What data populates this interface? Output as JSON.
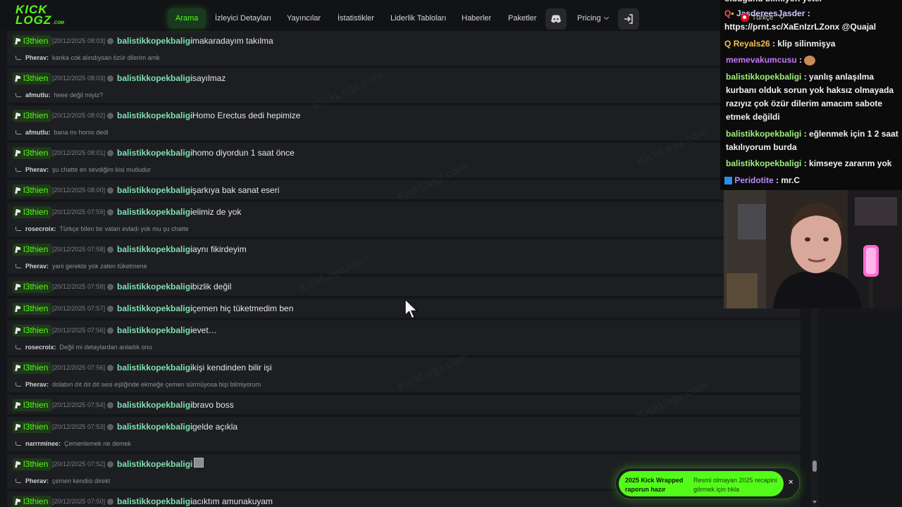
{
  "navbar": {
    "logo_top": "KICK",
    "logo_bottom": "LOGZ",
    "logo_suffix": ".COM",
    "items": [
      "Arama",
      "İzleyici Detayları",
      "Yayıncılar",
      "İstatistikler",
      "Liderlik Tabloları",
      "Haberler",
      "Paketler"
    ],
    "pricing": "Pricing",
    "language": "Türkçe"
  },
  "messages": [
    {
      "channel": "l3thien",
      "time": "[20/12/2025 08:03]",
      "user": "balistikkopekbaligi",
      "text": "makaradayım takılma",
      "reply_user": "Pherav:",
      "reply_text": "kanka cok alındıysan özür dilerim amk"
    },
    {
      "channel": "l3thien",
      "time": "[20/12/2025 08:03]",
      "user": "balistikkopekbaligi",
      "text": "sayılmaz",
      "reply_user": "afmutlu:",
      "reply_text": "heee değil miyiz?"
    },
    {
      "channel": "l3thien",
      "time": "[20/12/2025 08:02]",
      "user": "balistikkopekbaligi",
      "text": "Homo Erectus dedi hepimize",
      "reply_user": "afmutlu:",
      "reply_text": "bana mı homo dedi"
    },
    {
      "channel": "l3thien",
      "time": "[20/12/2025 08:01]",
      "user": "balistikkopekbaligi",
      "text": "homo diyordun 1 saat önce",
      "reply_user": "Pherav:",
      "reply_text": "şu chatte en sevdiğim kisi mutludur"
    },
    {
      "channel": "l3thien",
      "time": "[20/12/2025 08:00]",
      "user": "balistikkopekbaligi",
      "text": "şarkıya bak sanat eseri"
    },
    {
      "channel": "l3thien",
      "time": "[20/12/2025 07:59]",
      "user": "balistikkopekbaligi",
      "text": "elimiz de yok",
      "reply_user": "rosecroix:",
      "reply_text": "Türkçe bilen bir vatan evladı yok mu şu chatte"
    },
    {
      "channel": "l3thien",
      "time": "[20/12/2025 07:58]",
      "user": "balistikkopekbaligi",
      "text": "aynı fikirdeyim",
      "reply_user": "Pherav:",
      "reply_text": "yani gerekte yok zaten tüketmene"
    },
    {
      "channel": "l3thien",
      "time": "[20/12/2025 07:58]",
      "user": "balistikkopekbaligi",
      "text": "bizlik değil"
    },
    {
      "channel": "l3thien",
      "time": "[20/12/2025 07:57]",
      "user": "balistikkopekbaligi",
      "text": "çemen hiç tüketmedim ben"
    },
    {
      "channel": "l3thien",
      "time": "[20/12/2025 07:56]",
      "user": "balistikkopekbaligi",
      "text": "evet…",
      "reply_user": "rosecroix:",
      "reply_text": "Değil mi detaylardan anladık onu"
    },
    {
      "channel": "l3thien",
      "time": "[20/12/2025 07:56]",
      "user": "balistikkopekbaligi",
      "text": "kişi kendinden bilir işi",
      "reply_user": "Pherav:",
      "reply_text": "dolabın dıt dıt dıt sesi eşliğinde ekmeğe çemen sürmüyosa bişi bilmiyorum"
    },
    {
      "channel": "l3thien",
      "time": "[20/12/2025 07:54]",
      "user": "balistikkopekbaligi",
      "text": "bravo boss"
    },
    {
      "channel": "l3thien",
      "time": "[20/12/2025 07:53]",
      "user": "balistikkopekbaligi",
      "text": "gelde açıkla",
      "reply_user": "narrrminee:",
      "reply_text": "Çemenlemek ne demek"
    },
    {
      "channel": "l3thien",
      "time": "[20/12/2025 07:52]",
      "user": "balistikkopekbaligi",
      "text": "",
      "emote": true,
      "reply_user": "Pherav:",
      "reply_text": "çemen kendisi direkt"
    },
    {
      "channel": "l3thien",
      "time": "[20/12/2025 07:50]",
      "user": "balistikkopekbaligi",
      "text": "acıktım amunakuyam"
    }
  ],
  "chat": {
    "top_partial": "oldugunu bilmiyon yeter",
    "lines": [
      {
        "user": "JasdereesJasder",
        "color": "#c9c9ff",
        "text": " :",
        "extra": "https://prnt.sc/XaEnIzrLZonx @Quajal"
      },
      {
        "user": "Reyals26",
        "color": "#f2c14e",
        "text": " : klip silinmişya"
      },
      {
        "user": "memevakumcusu",
        "color": "#c777ff",
        "text": " :"
      },
      {
        "user": "balistikkopekbaligi",
        "color": "#9ff07a",
        "text": " : yanlış anlaşılma kurbanı olduk sorun yok haksız olmayada razıyız çok özür dilerim amacım sabote etmek değildi"
      },
      {
        "user": "balistikkopekbaligi",
        "color": "#9ff07a",
        "text": " : eğlenmek için 1 2 saat takılıyorum burda"
      },
      {
        "user": "balistikkopekbaligi",
        "color": "#9ff07a",
        "text": " : kimseye zararım yok"
      },
      {
        "user": "Peridotite",
        "color": "#b98cff",
        "text": " : mr.C"
      }
    ]
  },
  "toast": {
    "title": "2025 Kick Wrapped raporun hazır",
    "body": "Resmi olmayan 2025 recapini görmek için tıkla",
    "close": "×"
  },
  "watermark": "KickLogz.com",
  "scroll_position": 0.92
}
